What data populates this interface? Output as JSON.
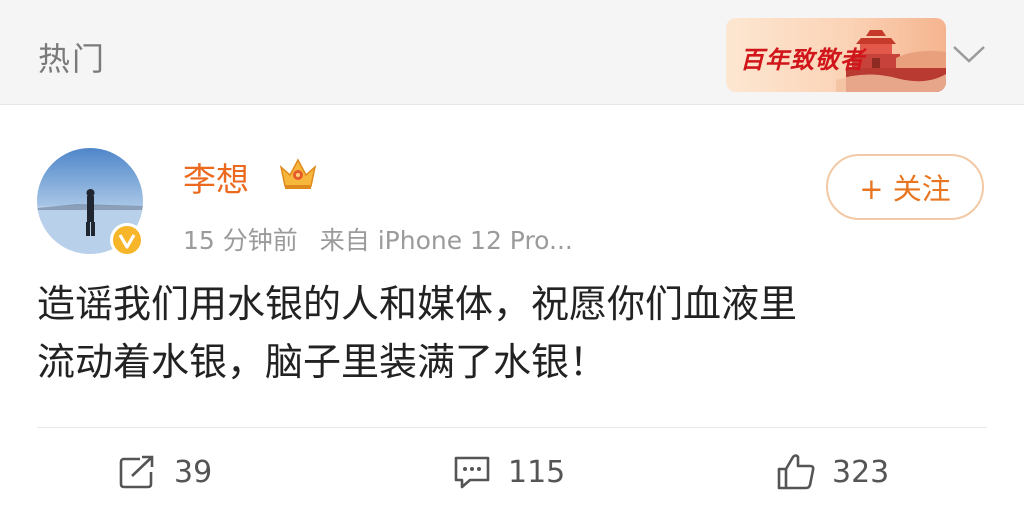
{
  "header": {
    "title": "热门",
    "banner_text": "百年致敬者"
  },
  "post": {
    "username": "李想",
    "time": "15 分钟前",
    "source": "来自 iPhone 12 Pro...",
    "follow_label": "+ 关注",
    "content_line1": "造谣我们用水银的人和媒体，祝愿你们血液里",
    "content_line2": "流动着水银，脑子里装满了水银！"
  },
  "actions": {
    "reposts": "39",
    "comments": "115",
    "likes": "323"
  },
  "colors": {
    "username": "#eb6a1f",
    "follow_border": "#f3c9a5",
    "follow_text": "#e87520",
    "banner_text": "#d0161a"
  },
  "icons": [
    "chevron-down-icon",
    "crown-icon",
    "verified-icon",
    "repost-icon",
    "comment-icon",
    "like-icon"
  ]
}
